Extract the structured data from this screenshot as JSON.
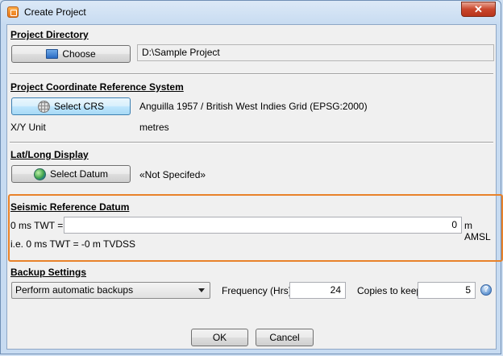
{
  "window": {
    "title": "Create Project",
    "close_label": "✕"
  },
  "project_directory": {
    "heading": "Project Directory",
    "choose_label": "Choose",
    "path": "D:\\Sample Project"
  },
  "crs": {
    "heading": "Project Coordinate Reference System",
    "select_label": "Select CRS",
    "value": "Anguilla 1957 / British West Indies Grid (EPSG:2000)",
    "unit_label": "X/Y Unit",
    "unit_value": "metres"
  },
  "latlong": {
    "heading": "Lat/Long Display",
    "select_label": "Select Datum",
    "value": "«Not Specifed»"
  },
  "seismic": {
    "heading": "Seismic Reference Datum",
    "twt_label": "0 ms TWT =",
    "twt_value": "0",
    "unit_suffix": "m AMSL",
    "note": "i.e. 0 ms TWT = -0 m TVDSS"
  },
  "backup": {
    "heading": "Backup Settings",
    "mode_selected": "Perform automatic backups",
    "frequency_label": "Frequency (Hrs)",
    "frequency_value": "24",
    "copies_label": "Copies to keep",
    "copies_value": "5",
    "help_label": "?"
  },
  "footer": {
    "ok_label": "OK",
    "cancel_label": "Cancel"
  },
  "colors": {
    "highlight": "#e8822a",
    "title_bar": "#c7dbf1"
  },
  "icons": [
    "app-icon",
    "folder-icon",
    "globe-grid-icon",
    "globe-icon",
    "help-icon",
    "close-icon",
    "chevron-down-icon"
  ]
}
